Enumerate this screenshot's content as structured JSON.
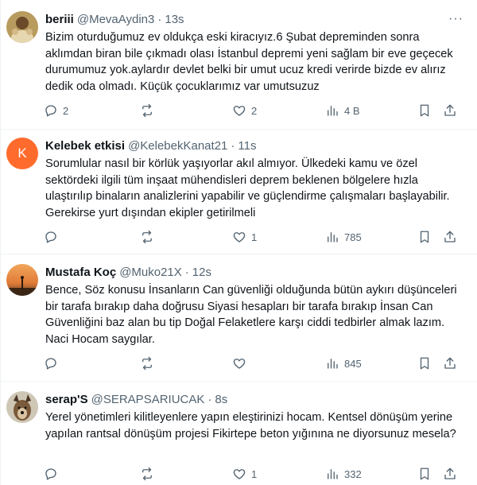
{
  "tweets": [
    {
      "name": "beriii",
      "handle": "@MevaAydin3",
      "time": "13s",
      "text": "Bizim oturduğumuz ev oldukça eski kiracıyız.6 Şubat depreminden sonra aklımdan biran bile çıkmadı olası İstanbul depremi yeni sağlam bir eve geçecek durumumuz yok.aylardır devlet belki bir umut ucuz kredi verirde bizde ev alırız dedik oda olmadı. Küçük çocuklarımız var umutsuzuz",
      "replies": "2",
      "retweets": "",
      "likes": "2",
      "views": "4 B",
      "avatar_icon": "profile-photo-icon"
    },
    {
      "name": "Kelebek etkisi",
      "handle": "@KelebekKanat21",
      "time": "11s",
      "text": "Sorumlular nasıl bir körlük yaşıyorlar akıl almıyor. Ülkedeki kamu ve özel sektördeki ilgili tüm inşaat mühendisleri deprem beklenen bölgelere hızla ulaştırılıp binaların analizlerini yapabilir ve güçlendirme çalışmaları başlayabilir. Gerekirse yurt dışından  ekipler getirilmeli",
      "replies": "",
      "retweets": "",
      "likes": "1",
      "views": "785",
      "avatar_letter": "K",
      "avatar_color": "#ff6b2c"
    },
    {
      "name": "Mustafa Koç",
      "handle": "@Muko21X",
      "time": "12s",
      "text": "Bence, Söz konusu İnsanların Can güvenliği olduğunda bütün aykırı düşünceleri bir tarafa bırakıp daha doğrusu Siyasi hesapları bir tarafa bırakıp İnsan Can Güvenliğini baz alan bu tip Doğal Felaketlere karşı ciddi tedbirler almak lazım. Naci Hocam saygılar.",
      "replies": "",
      "retweets": "",
      "likes": "",
      "views": "845",
      "avatar_icon": "sunset-photo-icon"
    },
    {
      "name": "serap'S",
      "handle": "@SERAPSARIUCAK",
      "time": "8s",
      "text": "Yerel yönetimleri kilitleyenlere yapın eleştirinizi hocam. Kentsel dönüşüm yerine yapılan rantsal dönüşüm projesi Fikirtepe beton yığınına ne diyorsunuz mesela?",
      "replies": "",
      "retweets": "",
      "likes": "1",
      "views": "332",
      "avatar_icon": "dog-photo-icon"
    }
  ],
  "separator": "·",
  "more_glyph": "···"
}
